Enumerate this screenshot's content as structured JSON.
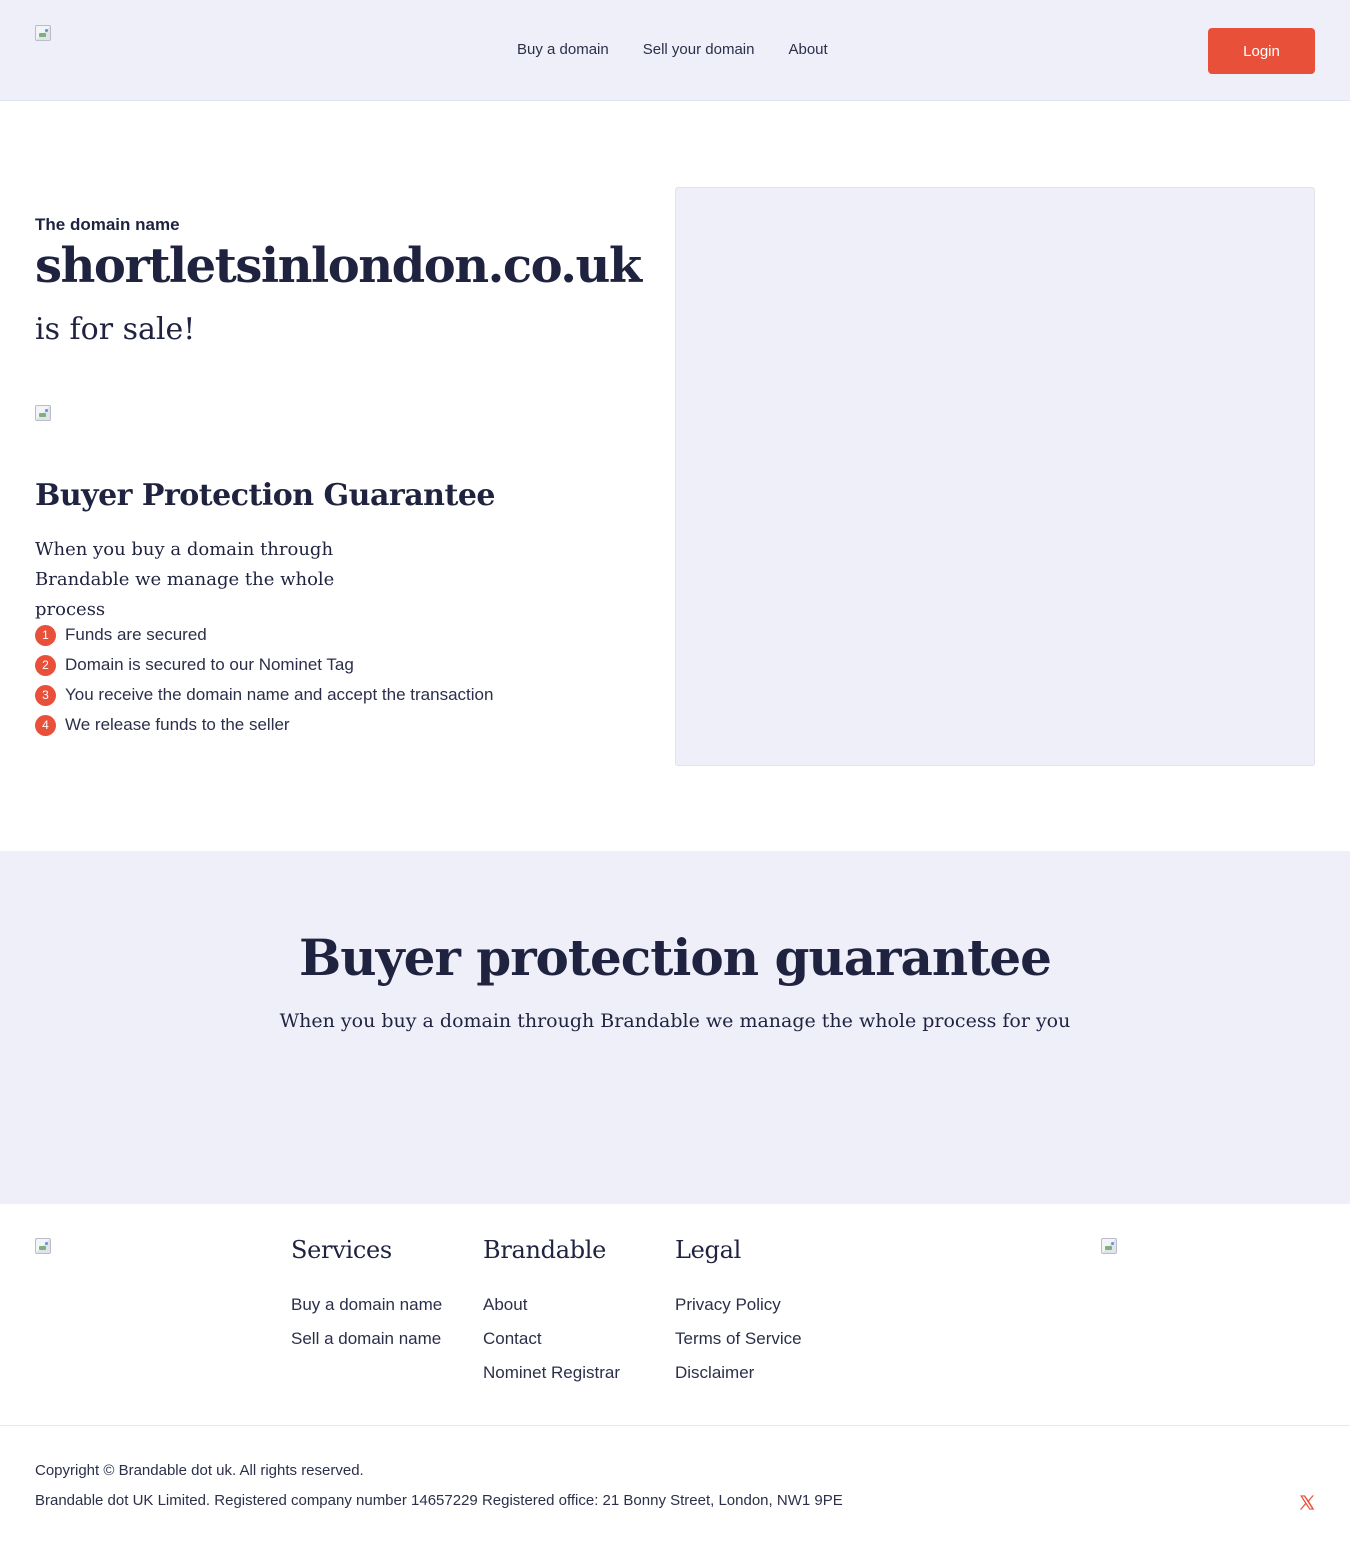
{
  "colors": {
    "accent": "#e8503a",
    "surface": "#eeeff8",
    "text": "#1f2340"
  },
  "header": {
    "logo_icon": "broken-image-icon",
    "nav": [
      {
        "label": "Buy a domain"
      },
      {
        "label": "Sell your domain"
      },
      {
        "label": "About"
      }
    ],
    "login_label": "Login"
  },
  "hero": {
    "eyebrow": "The domain name",
    "domain": "shortletsinlondon.co.uk",
    "for_sale": "is for sale!",
    "image_icon": "broken-image-icon"
  },
  "protection": {
    "title": "Buyer Protection Guarantee",
    "text_line1": "When you buy a domain through",
    "text_line2": "Brandable we manage the whole process",
    "steps": [
      {
        "num": "1",
        "label": "Funds are secured"
      },
      {
        "num": "2",
        "label": "Domain is secured to our Nominet Tag"
      },
      {
        "num": "3",
        "label": "You receive the domain name and accept the transaction"
      },
      {
        "num": "4",
        "label": "We release funds to the seller"
      }
    ]
  },
  "band": {
    "title": "Buyer protection guarantee",
    "subtitle": "When you buy a domain through Brandable we manage the whole process for you"
  },
  "footer": {
    "services": {
      "title": "Services",
      "links": [
        "Buy a domain name",
        "Sell a domain name"
      ]
    },
    "brandable": {
      "title": "Brandable",
      "links": [
        "About",
        "Contact",
        "Nominet Registrar"
      ]
    },
    "legal": {
      "title": "Legal",
      "links": [
        "Privacy Policy",
        "Terms of Service",
        "Disclaimer"
      ]
    },
    "copyright": "Copyright © Brandable dot uk. All rights reserved.",
    "company": "Brandable dot UK Limited. Registered company number 14657229 Registered office: 21 Bonny Street, London, NW1 9PE",
    "social_icon": "x-twitter-icon"
  }
}
